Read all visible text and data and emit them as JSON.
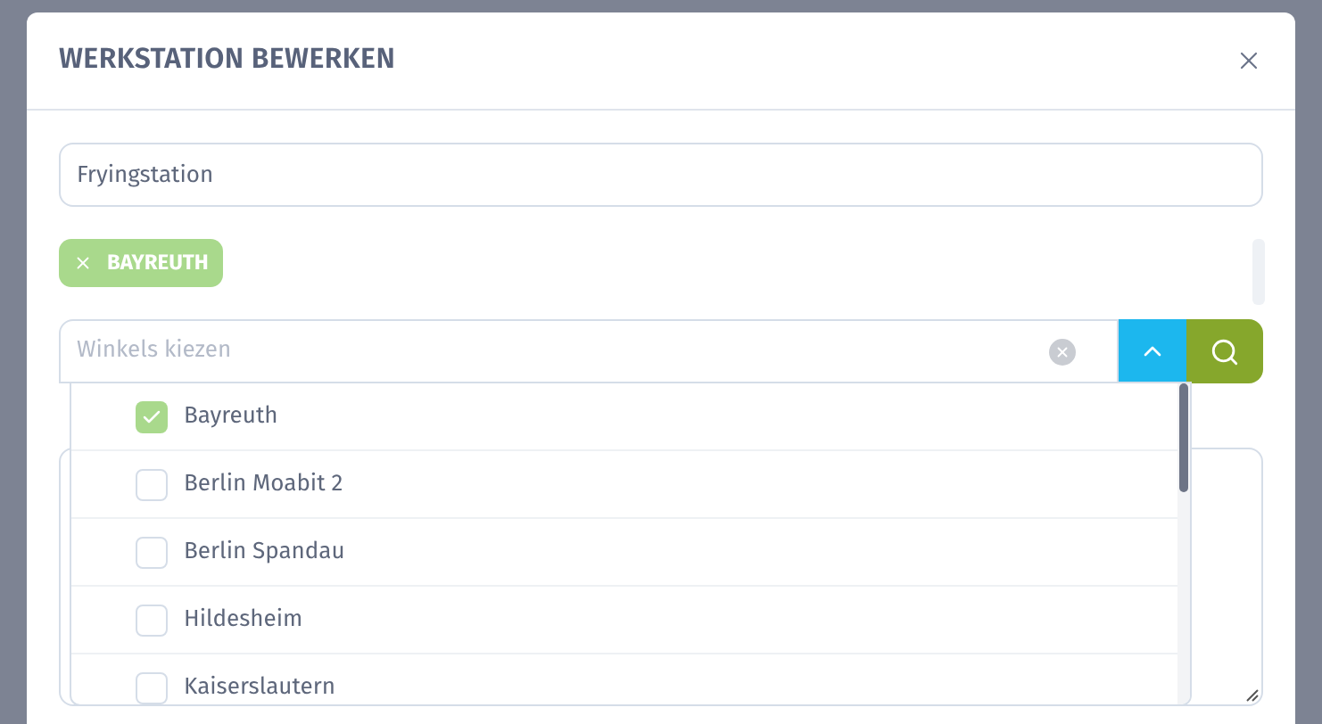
{
  "dialog": {
    "title": "WERKSTATION BEWERKEN",
    "name_field": {
      "value": "Fryingstation"
    },
    "tags": [
      {
        "label": "BAYREUTH"
      }
    ],
    "shop_select": {
      "placeholder": "Winkels kiezen",
      "expanded": true,
      "options": [
        {
          "label": "Bayreuth",
          "checked": true
        },
        {
          "label": "Berlin Moabit 2",
          "checked": false
        },
        {
          "label": "Berlin Spandau",
          "checked": false
        },
        {
          "label": "Hildesheim",
          "checked": false
        },
        {
          "label": "Kaiserslautern",
          "checked": false
        }
      ]
    }
  }
}
